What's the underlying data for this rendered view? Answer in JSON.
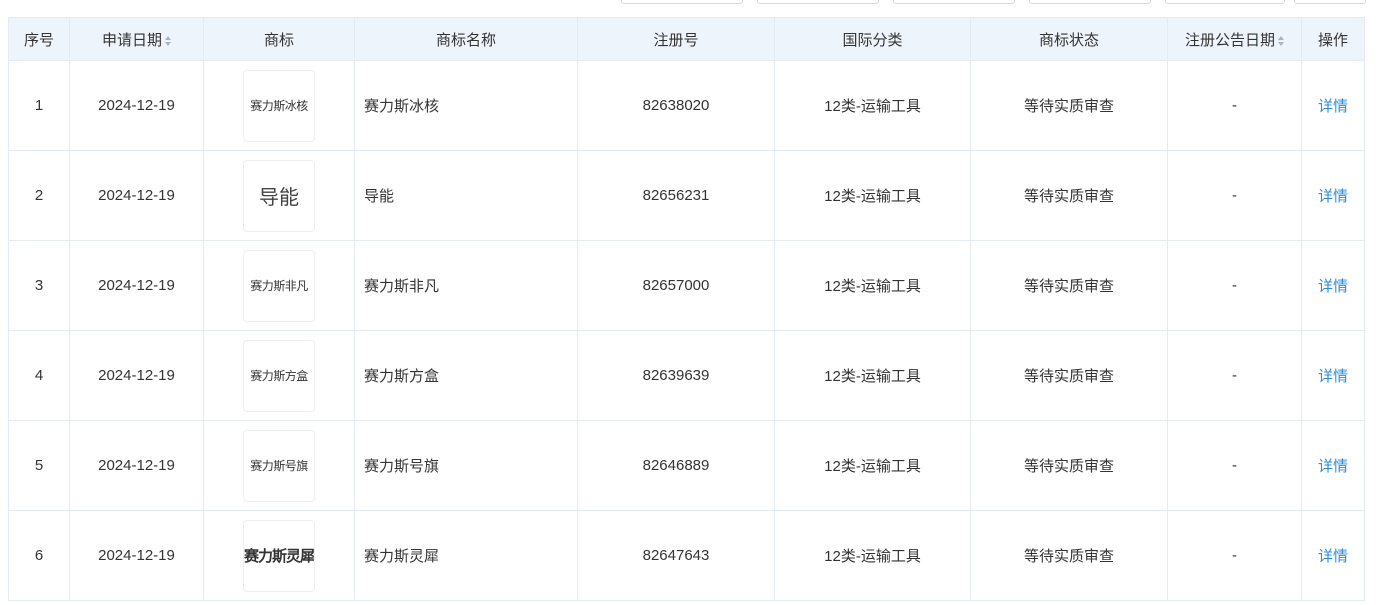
{
  "columns": {
    "index": "序号",
    "apply_date": "申请日期",
    "logo": "商标",
    "name": "商标名称",
    "reg_no": "注册号",
    "intl_class": "国际分类",
    "status": "商标状态",
    "announce_date": "注册公告日期",
    "action": "操作"
  },
  "rows": [
    {
      "index": "1",
      "apply_date": "2024-12-19",
      "logo_text": "赛力斯冰核",
      "name": "赛力斯冰核",
      "reg_no": "82638020",
      "intl_class": "12类-运输工具",
      "status": "等待实质审查",
      "announce_date": "-",
      "action": "详情"
    },
    {
      "index": "2",
      "apply_date": "2024-12-19",
      "logo_text": "导能",
      "name": "导能",
      "reg_no": "82656231",
      "intl_class": "12类-运输工具",
      "status": "等待实质审查",
      "announce_date": "-",
      "action": "详情"
    },
    {
      "index": "3",
      "apply_date": "2024-12-19",
      "logo_text": "赛力斯非凡",
      "name": "赛力斯非凡",
      "reg_no": "82657000",
      "intl_class": "12类-运输工具",
      "status": "等待实质审查",
      "announce_date": "-",
      "action": "详情"
    },
    {
      "index": "4",
      "apply_date": "2024-12-19",
      "logo_text": "赛力斯方盒",
      "name": "赛力斯方盒",
      "reg_no": "82639639",
      "intl_class": "12类-运输工具",
      "status": "等待实质审查",
      "announce_date": "-",
      "action": "详情"
    },
    {
      "index": "5",
      "apply_date": "2024-12-19",
      "logo_text": "赛力斯号旗",
      "name": "赛力斯号旗",
      "reg_no": "82646889",
      "intl_class": "12类-运输工具",
      "status": "等待实质审查",
      "announce_date": "-",
      "action": "详情"
    },
    {
      "index": "6",
      "apply_date": "2024-12-19",
      "logo_text": "赛力斯灵犀",
      "name": "赛力斯灵犀",
      "reg_no": "82647643",
      "intl_class": "12类-运输工具",
      "status": "等待实质审查",
      "announce_date": "-",
      "action": "详情"
    }
  ],
  "colors": {
    "header_bg": "#eef4fb",
    "border": "#e4ebf2",
    "link": "#2d8cd6",
    "text": "#333333"
  }
}
